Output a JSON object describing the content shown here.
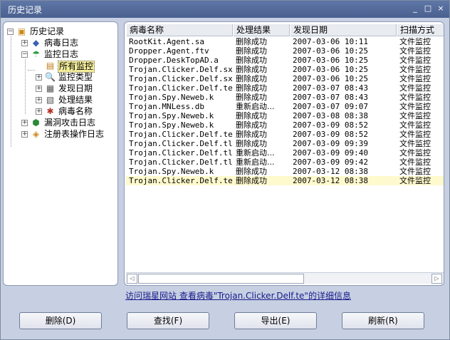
{
  "window": {
    "title": "历史记录",
    "controls": {
      "minimize": "_",
      "maximize": "□",
      "close": "×"
    }
  },
  "tree": {
    "root": {
      "label": "历史记录",
      "icon": "history-box-icon",
      "expander": "−"
    },
    "virus_log": {
      "label": "病毒日志",
      "icon": "virus-log-icon",
      "expander": "+"
    },
    "monitor_log": {
      "label": "监控日志",
      "icon": "umbrella-icon",
      "expander": "−"
    },
    "monitor_children": [
      {
        "label": "所有监控",
        "icon": "document-icon",
        "selected": true
      },
      {
        "label": "监控类型",
        "icon": "search-doc-icon",
        "expander": "+"
      },
      {
        "label": "发现日期",
        "icon": "calendar-icon",
        "expander": "+"
      },
      {
        "label": "处理结果",
        "icon": "result-doc-icon",
        "expander": "+"
      },
      {
        "label": "病毒名称",
        "icon": "bug-doc-icon",
        "expander": "+"
      }
    ],
    "vuln_log": {
      "label": "漏洞攻击日志",
      "icon": "shield-icon",
      "expander": "+"
    },
    "registry_log": {
      "label": "注册表操作日志",
      "icon": "registry-icon",
      "expander": "+"
    }
  },
  "list": {
    "columns": [
      "病毒名称",
      "处理结果",
      "发现日期",
      "扫描方式"
    ],
    "rows": [
      [
        "RootKit.Agent.sa",
        "删除成功",
        "2007-03-06 10:11",
        "文件监控"
      ],
      [
        "Dropper.Agent.ftv",
        "删除成功",
        "2007-03-06 10:25",
        "文件监控"
      ],
      [
        "Dropper.DeskTopAD.a",
        "删除成功",
        "2007-03-06 10:25",
        "文件监控"
      ],
      [
        "Trojan.Clicker.Delf.sx",
        "删除成功",
        "2007-03-06 10:25",
        "文件监控"
      ],
      [
        "Trojan.Clicker.Delf.sx",
        "删除成功",
        "2007-03-06 10:25",
        "文件监控"
      ],
      [
        "Trojan.Clicker.Delf.te",
        "删除成功",
        "2007-03-07 08:43",
        "文件监控"
      ],
      [
        "Trojan.Spy.Neweb.k",
        "删除成功",
        "2007-03-07 08:43",
        "文件监控"
      ],
      [
        "Trojan.MNLess.db",
        "重新启动...",
        "2007-03-07 09:07",
        "文件监控"
      ],
      [
        "Trojan.Spy.Neweb.k",
        "删除成功",
        "2007-03-08 08:38",
        "文件监控"
      ],
      [
        "Trojan.Spy.Neweb.k",
        "删除成功",
        "2007-03-09 08:52",
        "文件监控"
      ],
      [
        "Trojan.Clicker.Delf.te",
        "删除成功",
        "2007-03-09 08:52",
        "文件监控"
      ],
      [
        "Trojan.Clicker.Delf.tl",
        "删除成功",
        "2007-03-09 09:39",
        "文件监控"
      ],
      [
        "Trojan.Clicker.Delf.tl",
        "重新启动...",
        "2007-03-09 09:40",
        "文件监控"
      ],
      [
        "Trojan.Clicker.Delf.tl",
        "重新启动...",
        "2007-03-09 09:42",
        "文件监控"
      ],
      [
        "Trojan.Spy.Neweb.k",
        "删除成功",
        "2007-03-12 08:38",
        "文件监控"
      ],
      [
        "Trojan.Clicker.Delf.te",
        "删除成功",
        "2007-03-12 08:38",
        "文件监控"
      ]
    ],
    "highlighted_row": 15,
    "scroll": {
      "left_arrow": "◁",
      "right_arrow": "▷"
    }
  },
  "info_link": "访问瑞星网站 查看病毒\"Trojan.Clicker.Delf.te\"的详细信息",
  "buttons": {
    "delete": "删除(D)",
    "find": "查找(F)",
    "export": "导出(E)",
    "refresh": "刷新(R)"
  },
  "colors": {
    "titlebar": "#4f6797",
    "selected_node": "#f4ed9a",
    "highlight_row": "#fffacd",
    "link": "#1a1a8a"
  }
}
